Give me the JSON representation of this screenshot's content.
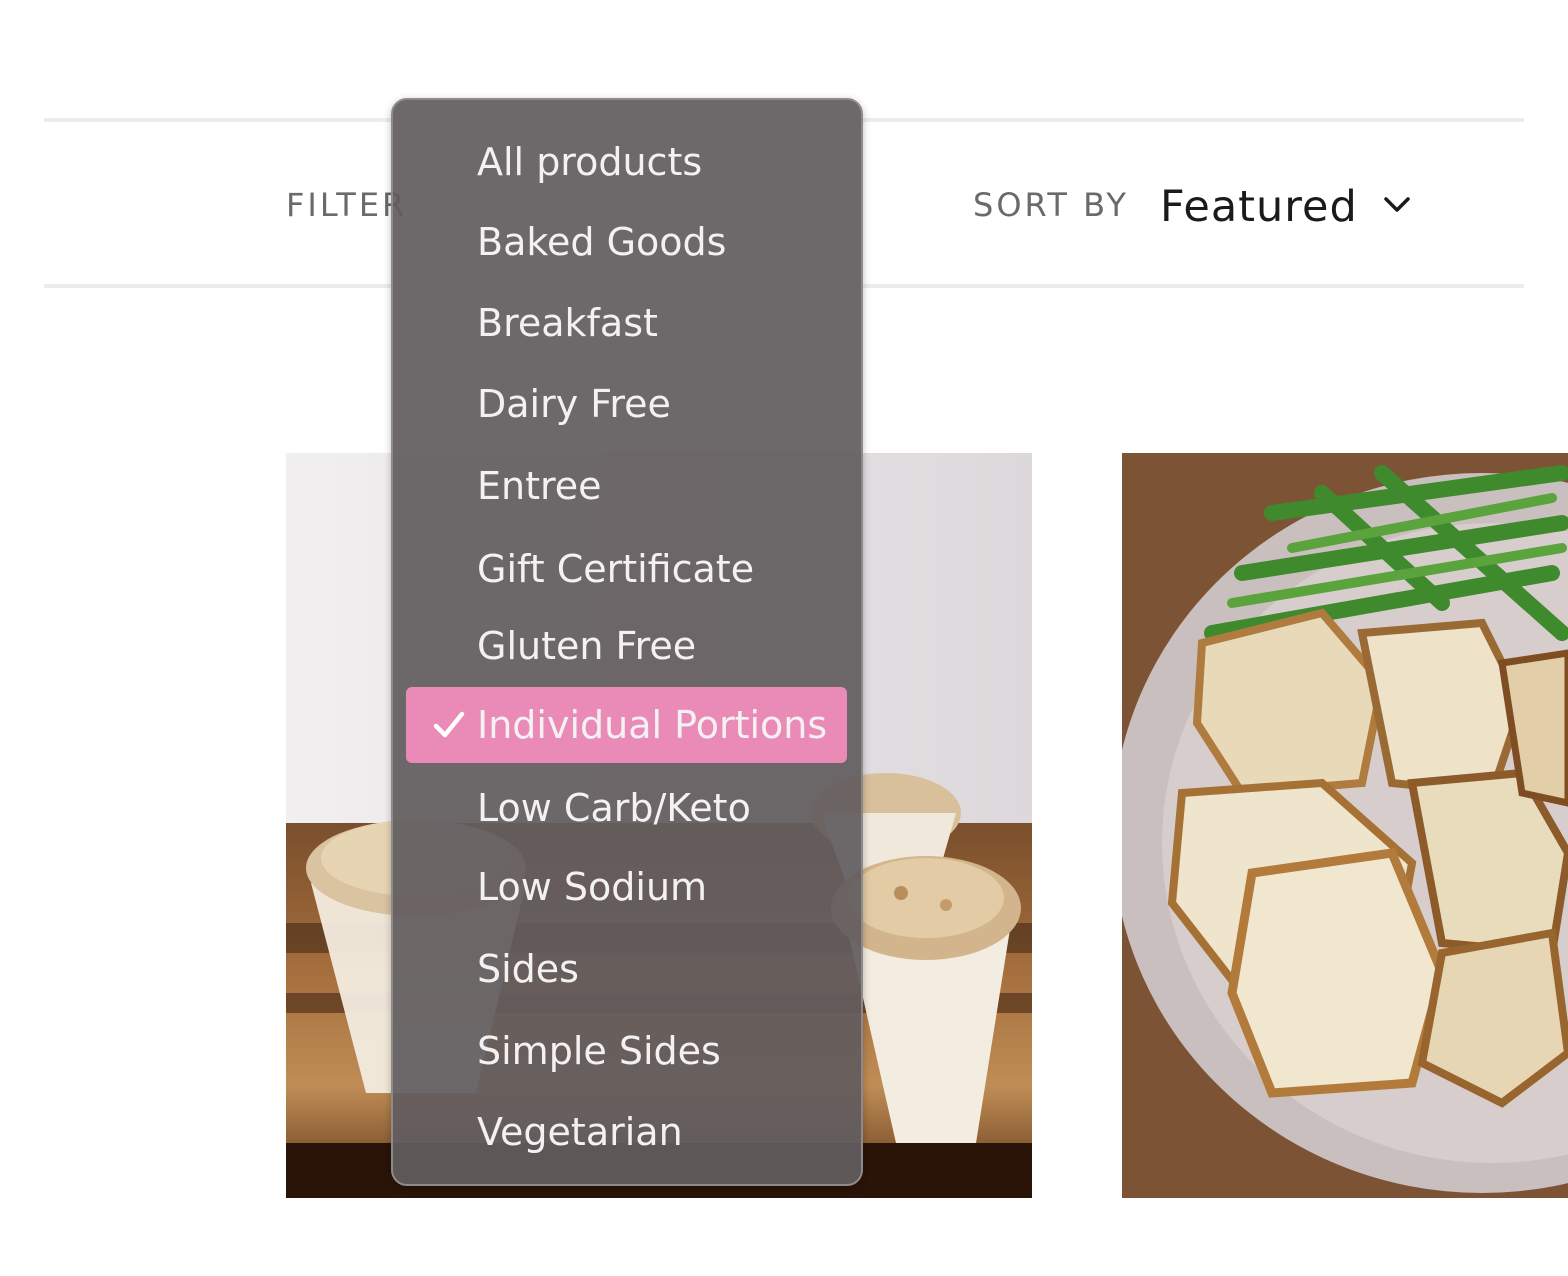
{
  "toolbar": {
    "filter_label": "FILTER",
    "sort_label": "SORT BY",
    "sort_value": "Featured"
  },
  "filter_menu": {
    "selected": "Individual Portions",
    "options": [
      "All products",
      "Baked Goods",
      "Breakfast",
      "Dairy Free",
      "Entree",
      "Gift Certificate",
      "Gluten Free",
      "Individual Portions",
      "Low Carb/Keto",
      "Low Sodium",
      "Sides",
      "Simple Sides",
      "Vegetarian"
    ]
  },
  "colors": {
    "menu_background": "#625c5f",
    "highlight": "#ea8ab7",
    "menu_text": "#f4f1f2",
    "rule": "#ececec"
  },
  "icons": {
    "sort_chevron": "chevron-down-icon",
    "selected_check": "checkmark-icon"
  }
}
